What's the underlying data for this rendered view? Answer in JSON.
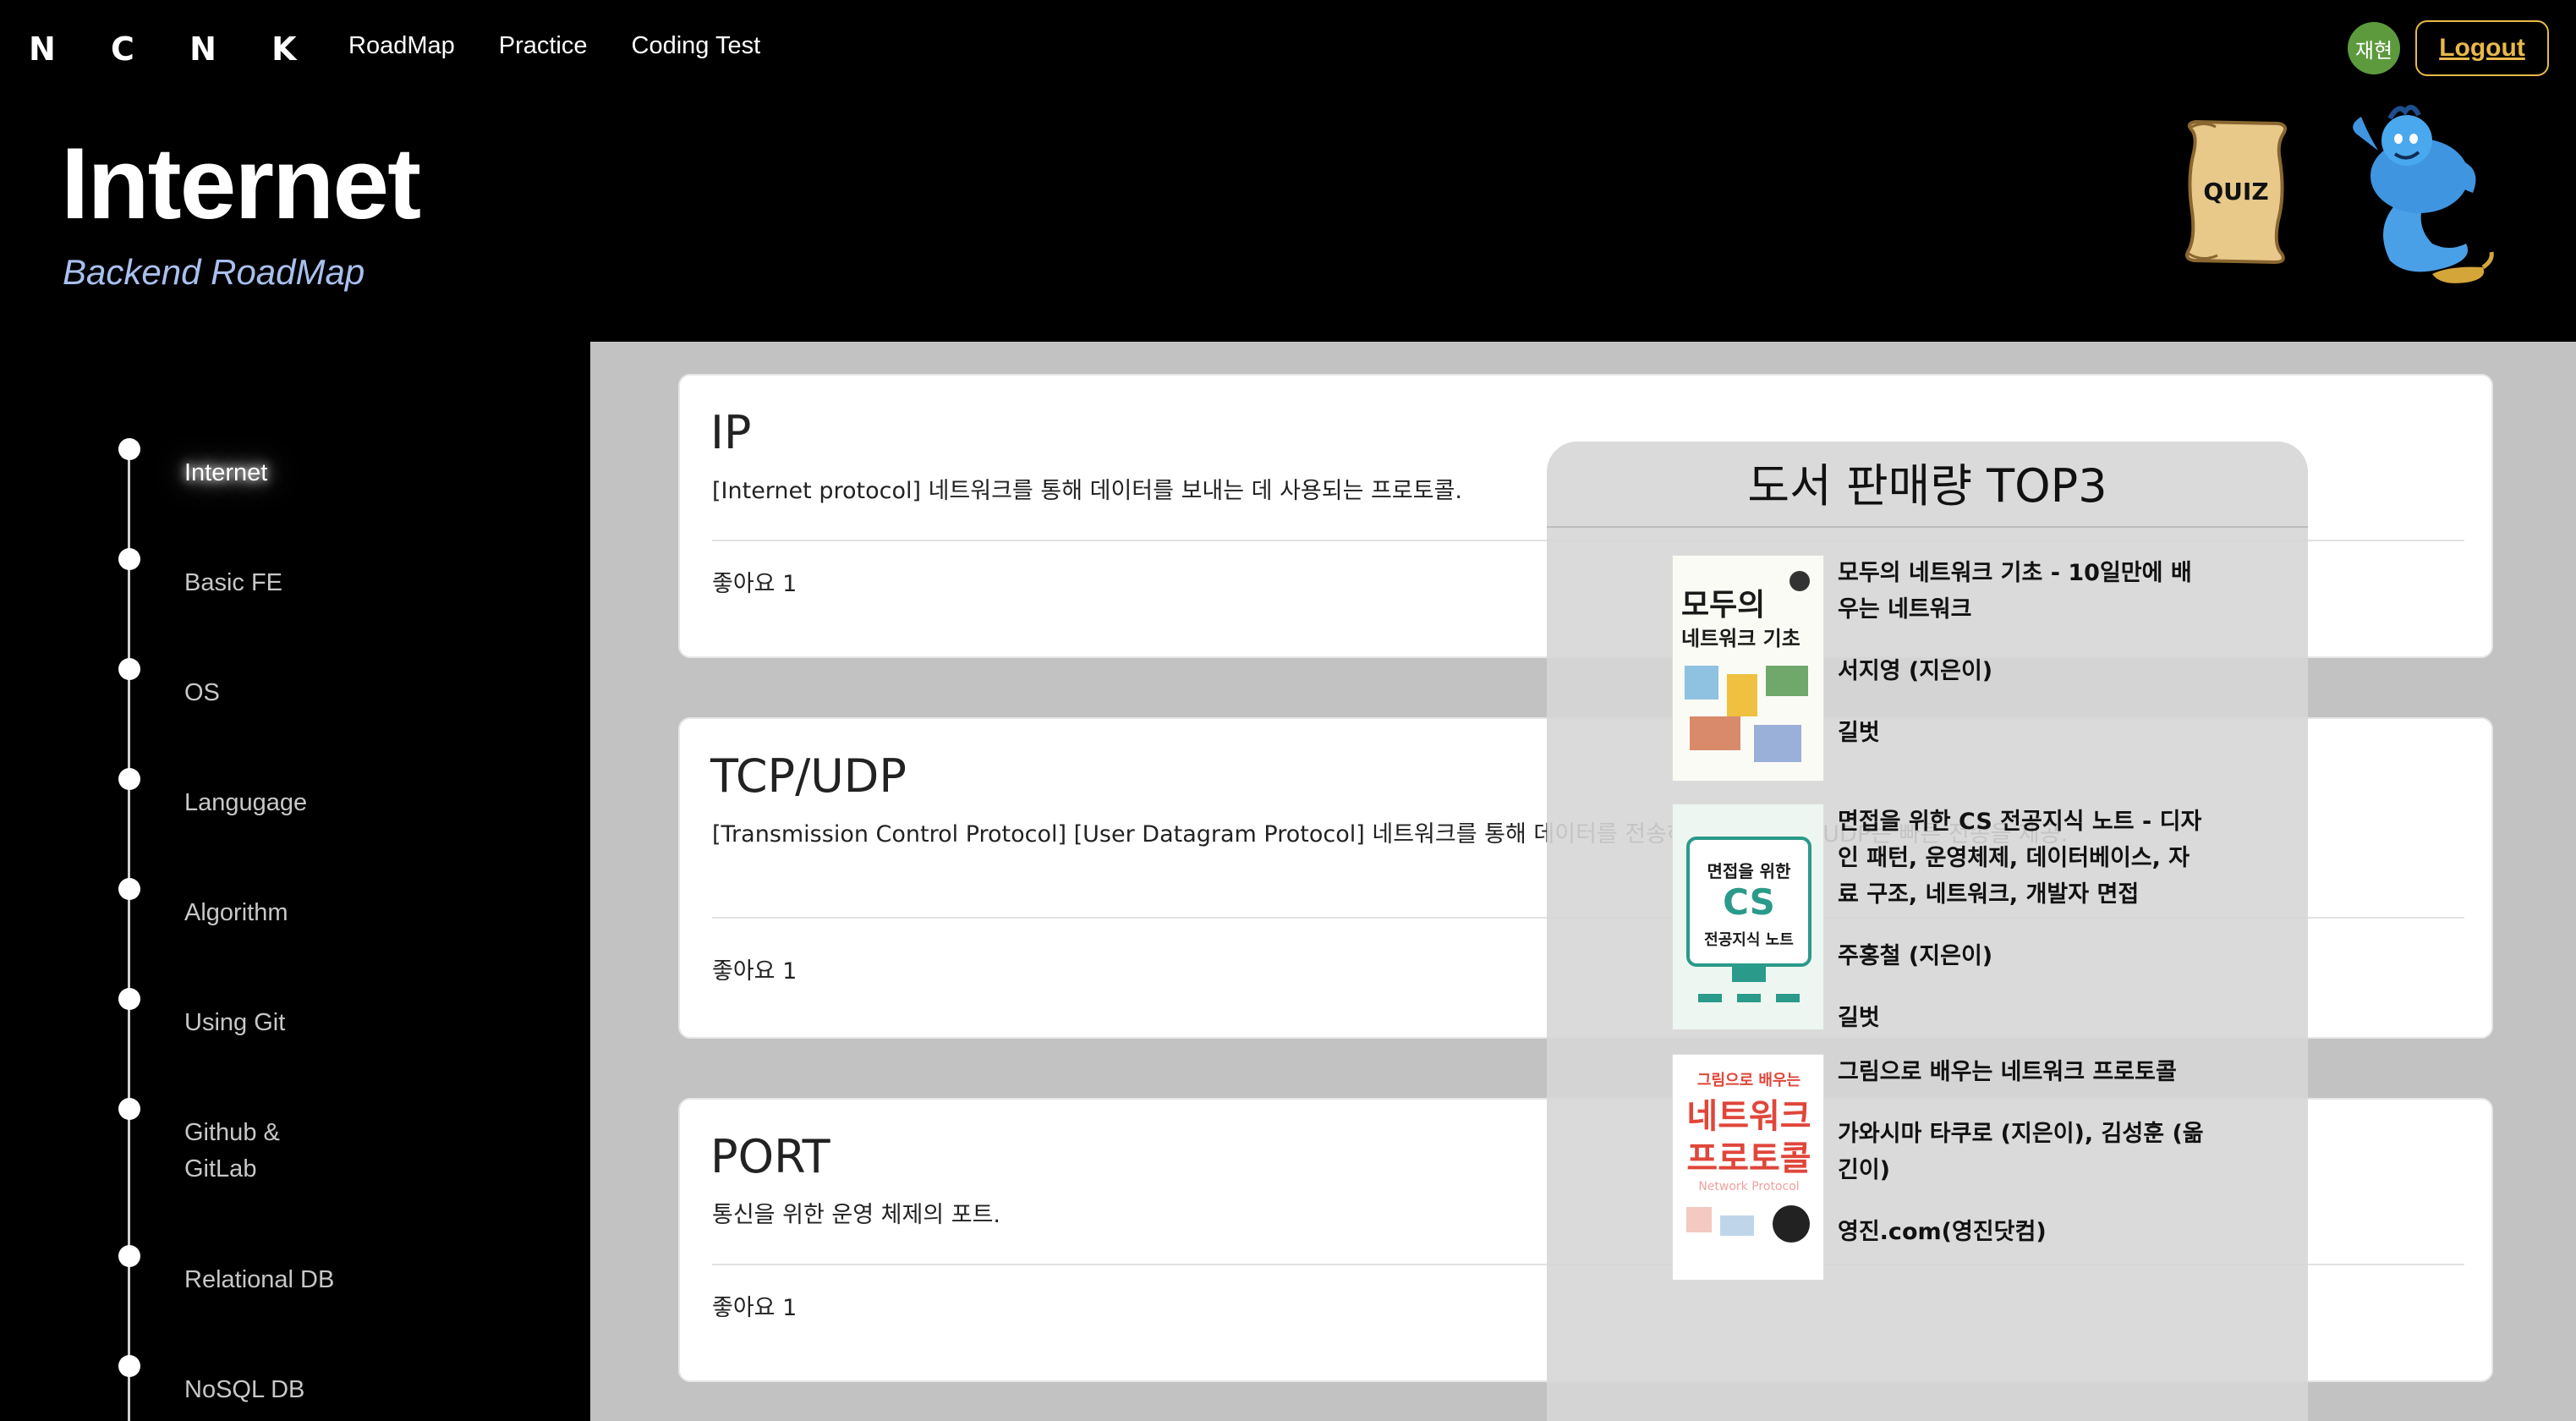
{
  "nav": {
    "logo": "N C N K",
    "links": [
      "RoadMap",
      "Practice",
      "Coding Test"
    ],
    "avatar": "재현",
    "logout": "Logout"
  },
  "hero": {
    "title": "Internet",
    "subtitle": "Backend RoadMap",
    "quiz_label": "QUIZ"
  },
  "sidebar": {
    "items": [
      {
        "label": "Internet",
        "active": true
      },
      {
        "label": "Basic FE"
      },
      {
        "label": "OS"
      },
      {
        "label": "Langugage"
      },
      {
        "label": "Algorithm"
      },
      {
        "label": "Using Git"
      },
      {
        "label": "Github & GitLab"
      },
      {
        "label": "Relational DB"
      },
      {
        "label": "NoSQL DB"
      }
    ]
  },
  "cards": [
    {
      "title": "IP",
      "desc": "[Internet protocol] 네트워크를 통해 데이터를 보내는 데 사용되는 프로토콜.",
      "like": "좋아요 1"
    },
    {
      "title": "TCP/UDP",
      "desc": "[Transmission Control Protocol] [User Datagram Protocol] 네트워크를 통해 데이터를 전송하는 ... 전송을, UDP는 빠른 전송을 제공.",
      "like": "좋아요 1"
    },
    {
      "title": "PORT",
      "desc": "통신을 위한 운영 체제의 포트.",
      "like": "좋아요 1"
    }
  ],
  "top3": {
    "title": "도서 판매량 TOP3",
    "books": [
      {
        "title": "모두의 네트워크 기초 - 10일만에 배우는 네트워크",
        "author": "서지영 (지은이)",
        "publisher": "길벗",
        "cover_lines": [
          "모두의",
          "네트워크 기초"
        ]
      },
      {
        "title": "면접을 위한 CS 전공지식 노트 - 디자인 패턴, 운영체제, 데이터베이스, 자료 구조, 네트워크, 개발자 면접",
        "author": "주홍철 (지은이)",
        "publisher": "길벗",
        "cover_lines": [
          "면접을 위한",
          "CS",
          "전공지식 노트"
        ]
      },
      {
        "title": "그림으로 배우는 네트워크 프로토콜",
        "author": "가와시마 타쿠로 (지은이), 김성훈 (옮긴이)",
        "publisher": "영진.com(영진닷컴)",
        "cover_lines": [
          "그림으로 배우는",
          "네트워크",
          "프로토콜",
          "Network Protocol"
        ]
      }
    ]
  },
  "colors": {
    "accent": "#e9b949",
    "subtitle": "#a9c0ee",
    "avatar": "#5d9a3d",
    "main_bg": "#c2c2c2"
  }
}
